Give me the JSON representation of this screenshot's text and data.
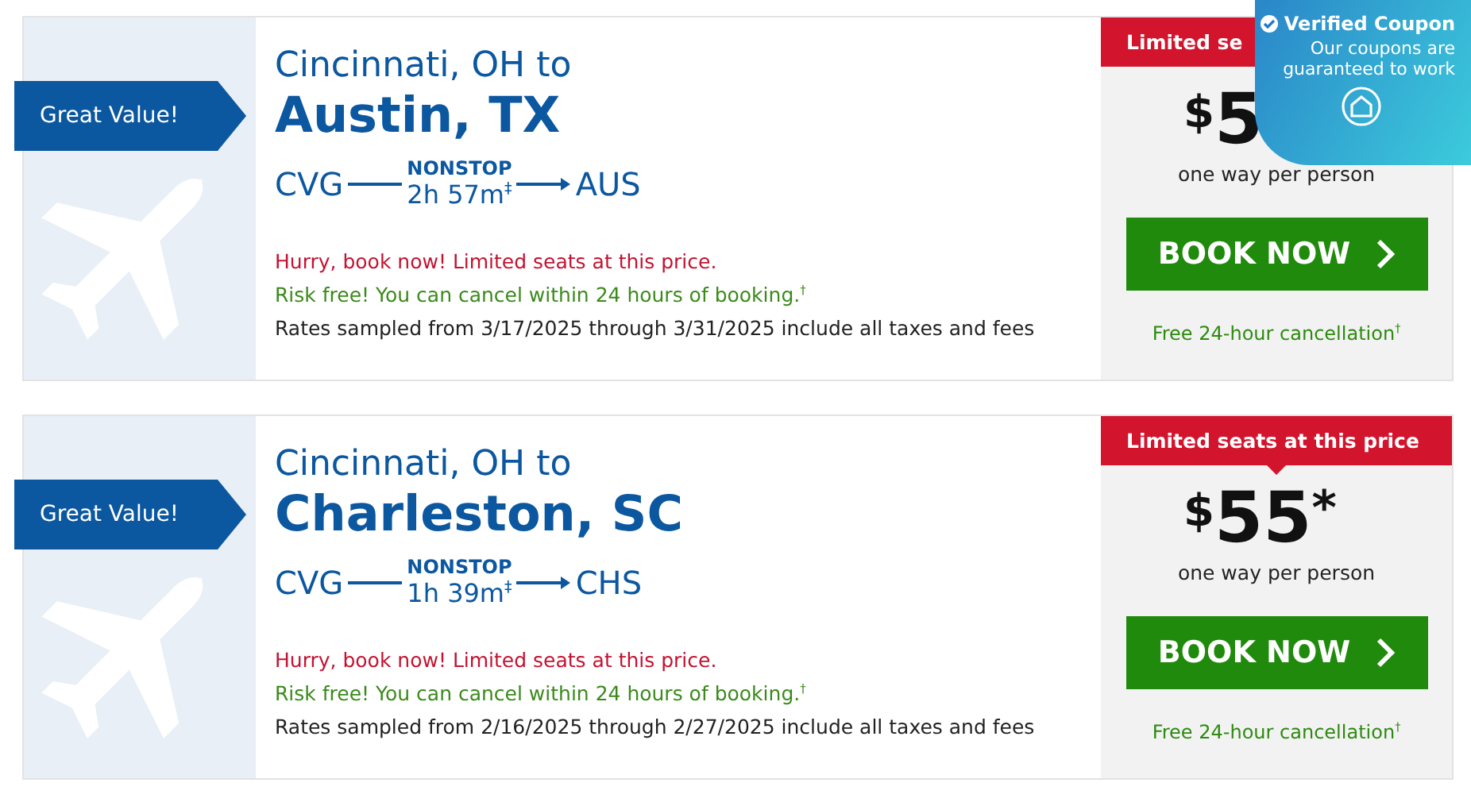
{
  "deals": [
    {
      "badge": "Great Value!",
      "origin_city": "Cincinnati, OH to",
      "destination_city": "Austin, TX",
      "from_code": "CVG",
      "to_code": "AUS",
      "flight_type": "NONSTOP",
      "duration": "2h 57m$^{‡}$",
      "urgency": "Hurry, book now! Limited seats at this price.",
      "risk_free": "Risk free! You can cancel within 24 hours of booking.$^{†}$",
      "rates_note": "Rates sampled from 3/17/2025 through 3/31/2025 include all taxes and fees",
      "limited_banner": "Limited se",
      "currency": "$",
      "amount": "5",
      "price_note": "one way per person",
      "button": "BOOK NOW",
      "cancellation": "Free 24-hour cancellation$^{†}$"
    },
    {
      "badge": "Great Value!",
      "origin_city": "Cincinnati, OH to",
      "destination_city": "Charleston, SC",
      "from_code": "CVG",
      "to_code": "CHS",
      "flight_type": "NONSTOP",
      "duration": "1h 39m$^{‡}$",
      "urgency": "Hurry, book now! Limited seats at this price.",
      "risk_free": "Risk free! You can cancel within 24 hours of booking.$^{†}$",
      "rates_note": "Rates sampled from 2/16/2025 through 2/27/2025 include all taxes and fees",
      "limited_banner": "Limited seats at this price",
      "currency": "$",
      "amount": "55",
      "price_mark": "*",
      "price_note": "one way per person",
      "button": "BOOK NOW",
      "cancellation": "Free 24-hour cancellation$^{†}$"
    }
  ],
  "coupon_popup": {
    "title": "Verified Coupon",
    "message": "Our coupons are guaranteed to work"
  }
}
